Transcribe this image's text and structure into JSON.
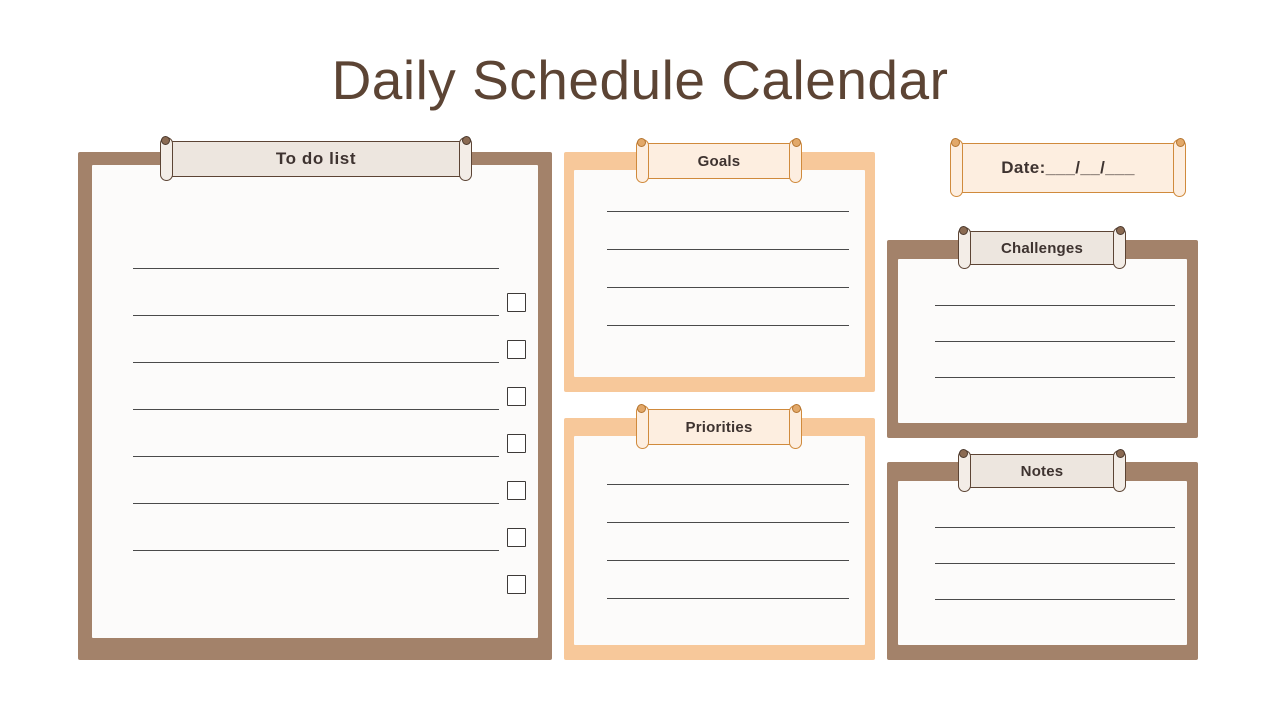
{
  "title": "Daily Schedule Calendar",
  "colors": {
    "title_text": "#5C4434",
    "brown_frame": "#A3826A",
    "peach_frame": "#F7C89A",
    "paper": "#FCFBFA",
    "brown_plate_fill": "#EDE6DF",
    "brown_plate_border": "#5C4434",
    "peach_plate_fill": "#FDEEE0",
    "peach_plate_border": "#D08A3C",
    "rule_line": "#4A4A4A",
    "checkbox_border": "#3E3A38",
    "page_background": "#FFFFFF"
  },
  "sections": {
    "todo": {
      "label": "To do list",
      "frame": "brown",
      "line_count": 7,
      "checkbox_count": 7
    },
    "goals": {
      "label": "Goals",
      "frame": "peach",
      "line_count": 4,
      "checkbox_count": 0
    },
    "priorities": {
      "label": "Priorities",
      "frame": "peach",
      "line_count": 4,
      "checkbox_count": 0
    },
    "date": {
      "label": "Date:___/__/___",
      "frame": "peach"
    },
    "challenges": {
      "label": "Challenges",
      "frame": "brown",
      "line_count": 3,
      "checkbox_count": 0
    },
    "notes": {
      "label": "Notes",
      "frame": "brown",
      "line_count": 3,
      "checkbox_count": 0
    }
  }
}
